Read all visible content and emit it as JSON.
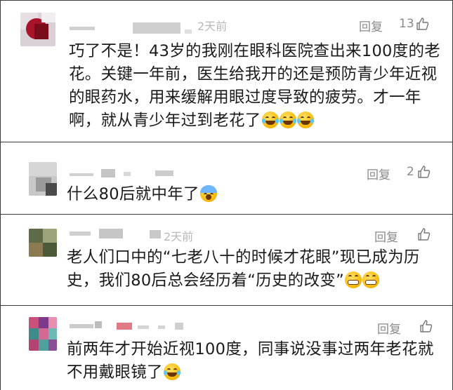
{
  "comments": [
    {
      "time": "2天前",
      "reply": "回复",
      "likes": "13",
      "line1": "巧了不是！43岁的我刚在眼科医院查出来100度的老",
      "line2": "花。关键一年前，医生给我开的还是预防青少年近视",
      "line3": "的眼药水，用来缓解用眼过度导致的疲劳。才一年",
      "line4": "啊，就从青少年过到老花了",
      "emojis": [
        "laugh-cry-emoji",
        "laugh-cry-emoji",
        "laugh-cry-emoji"
      ]
    },
    {
      "reply": "回复",
      "likes": "2",
      "line1": "什么80后就中年了",
      "emojis": [
        "scream-emoji"
      ]
    },
    {
      "time": "2天前",
      "reply": "回复",
      "likes": "",
      "line1": "老人们口中的“七老八十的时候才花眼”现已成为历",
      "line2": "史，我们80后总会经历着“历史的改变”",
      "emojis": [
        "grin-emoji",
        "grin-emoji"
      ]
    },
    {
      "reply": "回复",
      "likes": "",
      "line1": "前两年才开始近视100度，同事说没事过两年老花就",
      "line2": "不用戴眼镜了",
      "emojis": [
        "laugh-cry-emoji"
      ]
    }
  ],
  "colors": {
    "text": "#1a1a1a",
    "meta": "#8a8a8a",
    "divider": "#3a3a3a"
  }
}
